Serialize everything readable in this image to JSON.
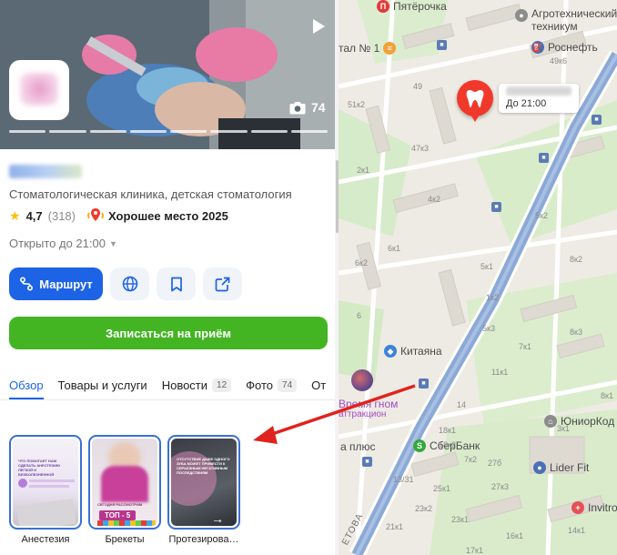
{
  "hero": {
    "photo_count": "74"
  },
  "org": {
    "category": "Стоматологическая клиника, детская стоматология",
    "rating": "4,7",
    "rating_count": "(318)",
    "award": "Хорошее место 2025",
    "hours": "Открыто до 21:00"
  },
  "actions": {
    "route_label": "Маршрут",
    "book_label": "Записаться на приём"
  },
  "tabs": [
    {
      "label": "Обзор",
      "count": ""
    },
    {
      "label": "Товары и услуги",
      "count": ""
    },
    {
      "label": "Новости",
      "count": "12"
    },
    {
      "label": "Фото",
      "count": "74"
    },
    {
      "label": "От",
      "count": ""
    }
  ],
  "stories": [
    {
      "label": "Анестезия",
      "text": "ЧТО ПОМОГАЕТ НАМ СДЕЛАТЬ АНЕСТЕЗИЮ ЛЕГКОЙ И БЕЗБОЛЕЗНЕННОЙ"
    },
    {
      "label": "Брекеты",
      "text": "СЕГОДНЯ РАССМОТРИМ",
      "badge": "ТОП - 5"
    },
    {
      "label": "Протезирова…",
      "text": "ОТСУТСТВИЕ ДАЖЕ ОДНОГО ЗУБА МОЖЕТ ПРИВЕСТИ К СЕРЬЕЗНЫМ НЕГАТИВНЫМ ПОСЛЕДСТВИЯМ"
    }
  ],
  "map": {
    "pin_hours": "До 21:00",
    "pois": [
      {
        "name": "Пятёрочка",
        "color": "#e23b3b",
        "glyph": "П"
      },
      {
        "name": "Агротехнический техникум",
        "color": "#8c8c8c",
        "glyph": "🎓"
      },
      {
        "name": "Роснефть",
        "color": "#4a6fb3",
        "glyph": "⛽"
      },
      {
        "name": "тал № 1",
        "color": "#f2a23a",
        "glyph": "≡"
      },
      {
        "name": "Китаяна",
        "color": "#3d83d6",
        "glyph": "🚗"
      },
      {
        "name": "ЮниорКод",
        "color": "#8c8c8c",
        "glyph": "🏠"
      },
      {
        "name": "СберБанк",
        "color": "#36a83a",
        "glyph": "S"
      },
      {
        "name": "Lider Fit",
        "color": "#4a6fb3",
        "glyph": "⬤"
      },
      {
        "name": "Invitro",
        "color": "#e25353",
        "glyph": "+"
      },
      {
        "name": "Время гном",
        "color": "#a24bc4",
        "glyph": ""
      },
      {
        "name": "аттракцион",
        "color": "#a24bc4",
        "glyph": ""
      },
      {
        "name": "а плюс",
        "color": "#555555",
        "glyph": ""
      }
    ],
    "house_numbers": [
      "Пятёрочка",
      "49",
      "51к2",
      "47к3",
      "2к1",
      "4к2",
      "6к1",
      "6к2",
      "5к1",
      "5к2",
      "1к2",
      "49к6",
      "8к2",
      "8к3",
      "7к1",
      "11к1",
      "14",
      "6",
      "8к1",
      "18к1",
      "18к2",
      "5к3",
      "7к2",
      "13/31",
      "27б",
      "27к3",
      "25к1",
      "23к2",
      "23к1",
      "14к1",
      "16к1",
      "21к1",
      "17к1",
      "3к1"
    ],
    "street": "ЕТОВА"
  },
  "colors": {
    "primary": "#1d63e5",
    "book": "#43b523",
    "pin": "#f0382b",
    "star": "#fabe14"
  }
}
